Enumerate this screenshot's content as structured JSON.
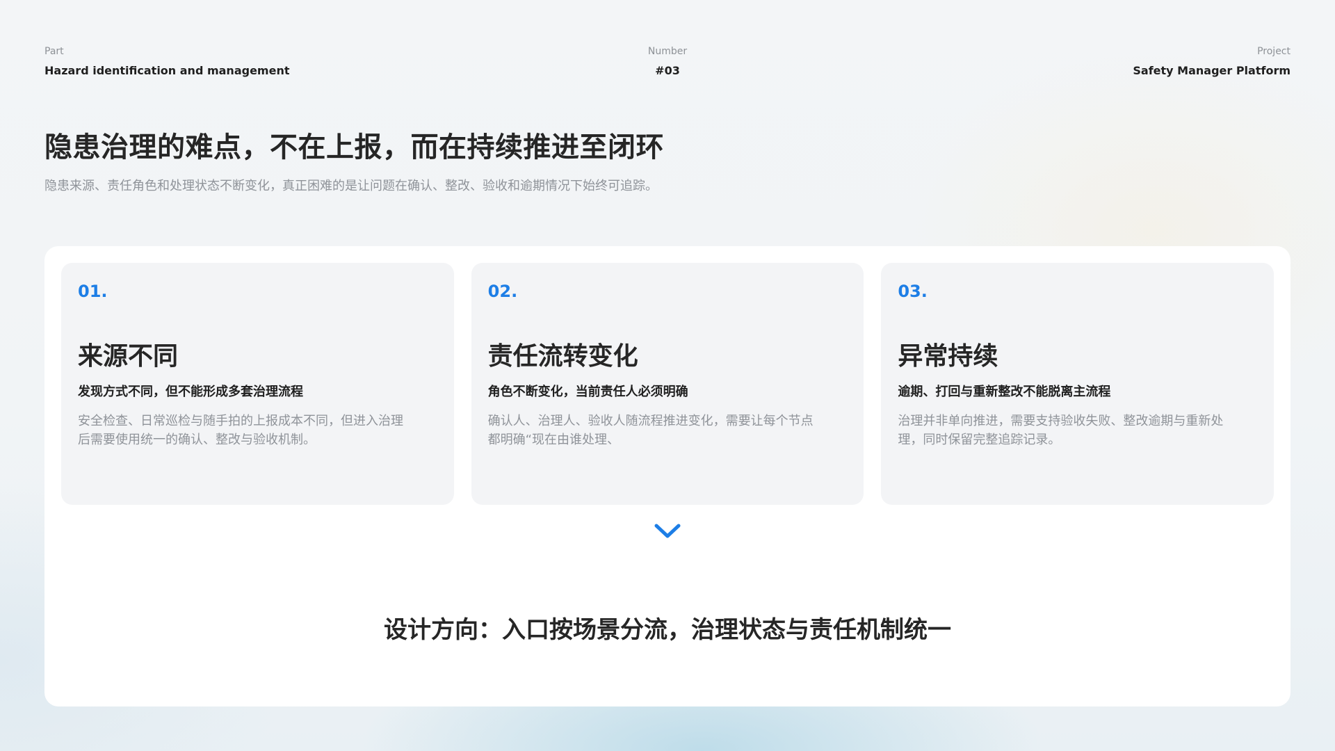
{
  "header": {
    "part_label": "Part",
    "part_value": "Hazard identification and management",
    "number_label": "Number",
    "number_value": "#03",
    "project_label": "Project",
    "project_value": "Safety Manager Platform"
  },
  "title": "隐患治理的难点，不在上报，而在持续推进至闭环",
  "subtitle": "隐患来源、责任角色和处理状态不断变化，真正困难的是让问题在确认、整改、验收和逾期情况下始终可追踪。",
  "cards": [
    {
      "number": "01.",
      "title": "来源不同",
      "subtitle": "发现方式不同，但不能形成多套治理流程",
      "description": "安全检查、日常巡检与随手拍的上报成本不同，但进入治理\n后需要使用统一的确认、整改与验收机制。"
    },
    {
      "number": "02.",
      "title": "责任流转变化",
      "subtitle": "角色不断变化，当前责任人必须明确",
      "description": "确认人、治理人、验收人随流程推进变化，需要让每个节点\n都明确“现在由谁处理、"
    },
    {
      "number": "03.",
      "title": "异常持续",
      "subtitle": "逾期、打回与重新整改不能脱离主流程",
      "description": "治理并非单向推进，需要支持验收失败、整改逾期与重新处\n理，同时保留完整追踪记录。"
    }
  ],
  "arrow_icon": "chevron-down-icon",
  "design_direction": "设计方向：入口按场景分流，治理状态与责任机制统一",
  "colors": {
    "accent": "#1d7ee6",
    "title": "#262626",
    "muted": "#8f9399",
    "card_bg": "#f3f4f6"
  }
}
